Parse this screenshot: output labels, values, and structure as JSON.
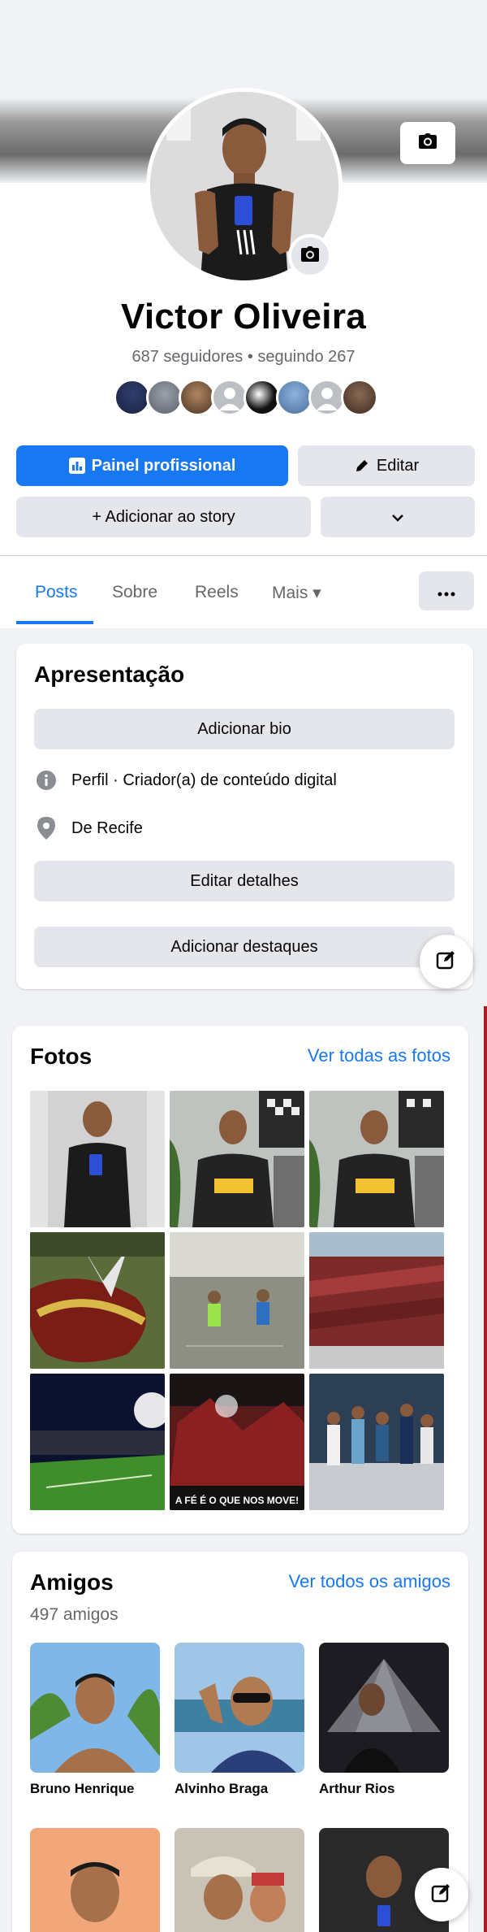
{
  "profile": {
    "name": "Victor Oliveira",
    "stats": "687 seguidores • seguindo 267"
  },
  "actions": {
    "professional_panel": "Painel profissional",
    "edit": "Editar",
    "add_story": "+ Adicionar ao story"
  },
  "tabs": [
    {
      "label": "Posts",
      "active": true
    },
    {
      "label": "Sobre"
    },
    {
      "label": "Reels"
    },
    {
      "label": "Mais ▾"
    }
  ],
  "intro": {
    "title": "Apresentação",
    "add_bio": "Adicionar bio",
    "profile_line": "Perfil · Criador(a) de conteúdo digital",
    "location_line": "De Recife",
    "edit_details": "Editar detalhes",
    "add_highlights": "Adicionar destaques"
  },
  "photos": {
    "title": "Fotos",
    "see_all": "Ver todas as fotos",
    "caption_photo_8": "A FÉ É O QUE NOS MOVE!"
  },
  "friends": {
    "title": "Amigos",
    "see_all": "Ver todos os amigos",
    "count": "497 amigos",
    "list": [
      {
        "name": "Bruno Henrique"
      },
      {
        "name": "Alvinho Braga"
      },
      {
        "name": "Arthur Rios"
      },
      {
        "name": ""
      },
      {
        "name": ""
      },
      {
        "name": ""
      }
    ]
  },
  "colors": {
    "accent": "#1877f2",
    "secondary_button": "#e4e6eb",
    "page_background": "#f0f2f5",
    "muted_text": "#65676b"
  },
  "icons": [
    "camera-icon",
    "chart-icon",
    "pencil-icon",
    "chevron-down-icon",
    "more-dots-icon",
    "info-icon",
    "location-pin-icon",
    "edit-square-icon"
  ]
}
